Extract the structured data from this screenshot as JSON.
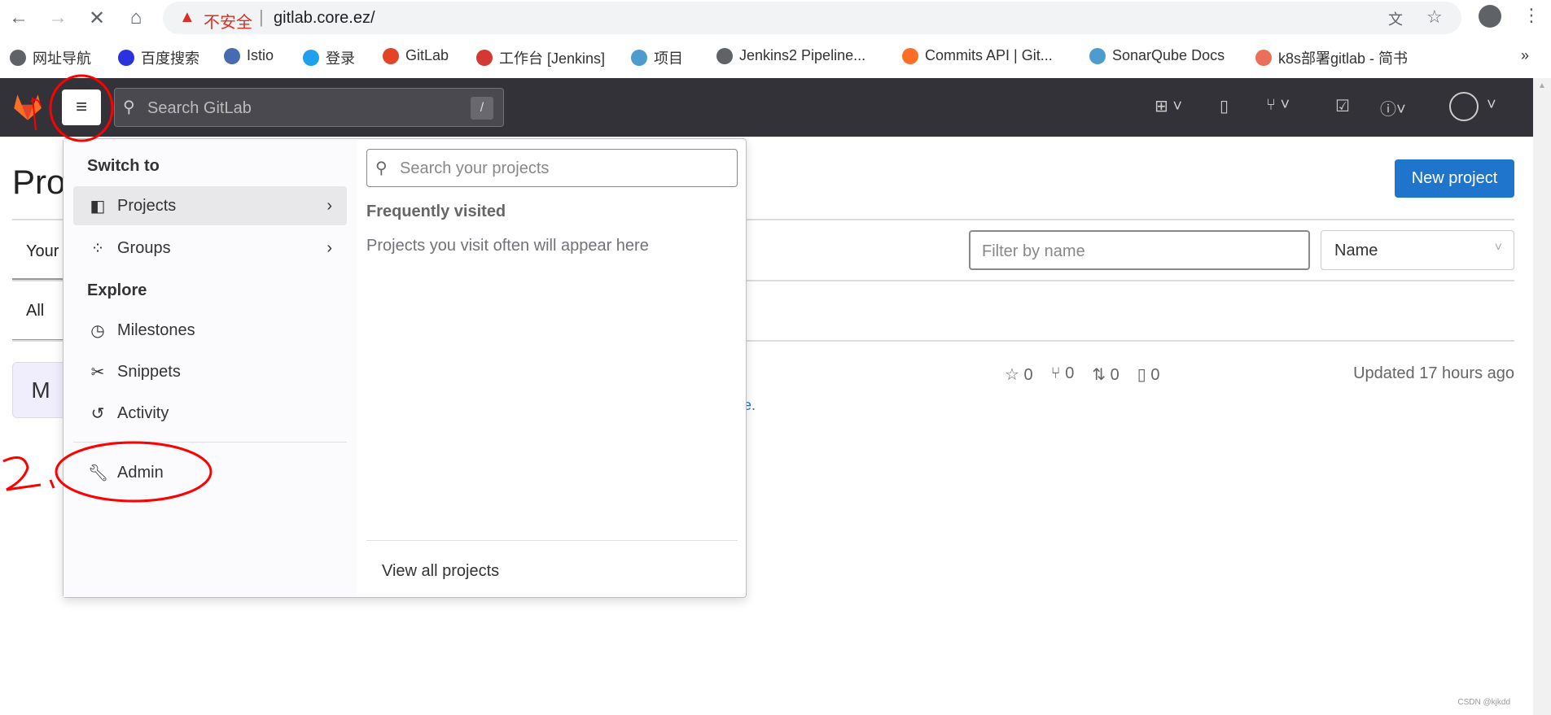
{
  "browser": {
    "security_label": "不安全",
    "url": "gitlab.core.ez/",
    "bookmarks": [
      {
        "label": "网址导航",
        "icon": "globe-icon",
        "color": "#5f6368"
      },
      {
        "label": "百度搜索",
        "icon": "baidu-paw-icon",
        "color": "#2932e1"
      },
      {
        "label": "Istio",
        "icon": "istio-sail-icon",
        "color": "#466bb0"
      },
      {
        "label": "登录",
        "icon": "g-login-icon",
        "color": "#1ea0ec"
      },
      {
        "label": "GitLab",
        "icon": "gitlab-fox-icon",
        "color": "#e24329"
      },
      {
        "label": "工作台 [Jenkins]",
        "icon": "jenkins-icon",
        "color": "#d33833"
      },
      {
        "label": "项目",
        "icon": "sonar-waves-icon",
        "color": "#4e9bcd"
      },
      {
        "label": "Jenkins2 Pipeline...",
        "icon": "globe-icon",
        "color": "#5f6368"
      },
      {
        "label": "Commits API | Git...",
        "icon": "gitlab-docs-icon",
        "color": "#fc6d26"
      },
      {
        "label": "SonarQube Docs",
        "icon": "sonar-waves-icon",
        "color": "#4e9bcd"
      },
      {
        "label": "k8s部署gitlab - 简书",
        "icon": "jianshu-icon",
        "color": "#ea6f5a"
      }
    ],
    "more": "»"
  },
  "header": {
    "search_placeholder": "Search GitLab",
    "search_shortcut": "/"
  },
  "menu": {
    "switch_to": "Switch to",
    "items_switch": [
      {
        "label": "Projects",
        "icon": "project-icon"
      },
      {
        "label": "Groups",
        "icon": "group-icon"
      }
    ],
    "explore": "Explore",
    "items_explore": [
      {
        "label": "Milestones",
        "icon": "clock-icon"
      },
      {
        "label": "Snippets",
        "icon": "scissors-icon"
      },
      {
        "label": "Activity",
        "icon": "history-icon"
      }
    ],
    "admin": "Admin",
    "search_placeholder": "Search your projects",
    "frequent_title": "Frequently visited",
    "frequent_empty": "Projects you visit often will appear here",
    "view_all": "View all projects"
  },
  "page": {
    "title": "Projects",
    "tab_your": "Your",
    "tab_all": "All",
    "new_project": "New project",
    "filter_placeholder": "Filter by name",
    "sort_value": "Name",
    "project": {
      "avatar": "M",
      "link_fragment": "ore.",
      "stars": "0",
      "forks": "0",
      "merge_requests": "0",
      "issues": "0",
      "updated": "Updated 17 hours ago"
    }
  },
  "watermark": "CSDN @kjkdd",
  "colors": {
    "header_bg": "#333238",
    "primary": "#1f75cb",
    "annotation": "#ff0000"
  }
}
